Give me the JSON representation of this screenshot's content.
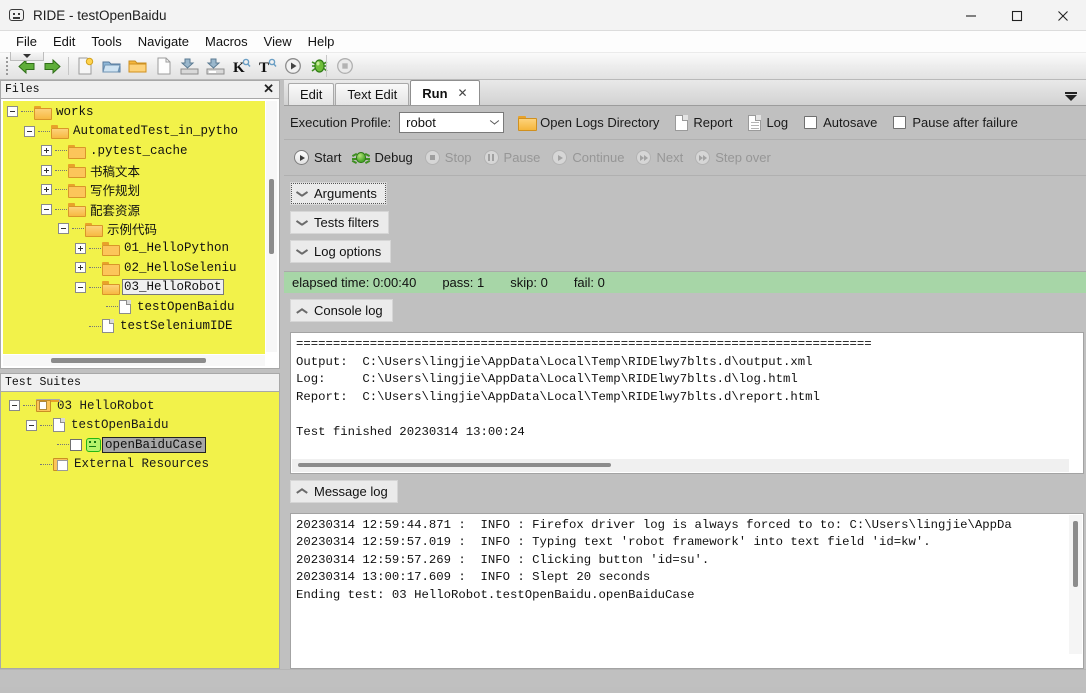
{
  "window": {
    "title": "RIDE - testOpenBaidu",
    "icon": "robot-face-icon",
    "controls": {
      "minimize": "—",
      "maximize": "□",
      "close": "✕"
    }
  },
  "menubar": {
    "items": [
      "File",
      "Edit",
      "Tools",
      "Navigate",
      "Macros",
      "View",
      "Help"
    ]
  },
  "toolbar": {
    "buttons": [
      {
        "name": "back-icon",
        "glyph": "green-left-arrow"
      },
      {
        "name": "forward-icon",
        "glyph": "green-right-arrow"
      },
      {
        "name": "new-project-icon",
        "glyph": "page-new"
      },
      {
        "name": "open-directory-icon",
        "glyph": "folder-open-blue"
      },
      {
        "name": "open-folder-icon",
        "glyph": "folder-yellow"
      },
      {
        "name": "new-file-icon",
        "glyph": "page-blank"
      },
      {
        "name": "save-icon",
        "glyph": "floppy-down"
      },
      {
        "name": "save-all-icon",
        "glyph": "floppy-down-all"
      },
      {
        "name": "search-keyword-icon",
        "glyph": "K"
      },
      {
        "name": "search-tests-icon",
        "glyph": "T"
      },
      {
        "name": "run-icon",
        "glyph": "play-circle"
      },
      {
        "name": "debug-icon",
        "glyph": "green-bug"
      },
      {
        "name": "stop-icon",
        "glyph": "stop-circle"
      }
    ]
  },
  "files_panel": {
    "title": "Files",
    "close_label": "✕",
    "tree": [
      {
        "label": "works",
        "depth": 0,
        "toggle": "minus",
        "icon": "folder"
      },
      {
        "label": "AutomatedTest_in_pytho",
        "depth": 1,
        "toggle": "minus",
        "icon": "folder"
      },
      {
        "label": ".pytest_cache",
        "depth": 2,
        "toggle": "plus",
        "icon": "folder"
      },
      {
        "label": "书稿文本",
        "depth": 2,
        "toggle": "plus",
        "icon": "folder"
      },
      {
        "label": "写作规划",
        "depth": 2,
        "toggle": "plus",
        "icon": "folder"
      },
      {
        "label": "配套资源",
        "depth": 2,
        "toggle": "minus",
        "icon": "folder"
      },
      {
        "label": "示例代码",
        "depth": 3,
        "toggle": "minus",
        "icon": "folder"
      },
      {
        "label": "01_HelloPython",
        "depth": 4,
        "toggle": "plus",
        "icon": "folder"
      },
      {
        "label": "02_HelloSeleniu",
        "depth": 4,
        "toggle": "plus",
        "icon": "folder"
      },
      {
        "label": "03_HelloRobot",
        "depth": 4,
        "toggle": "minus",
        "icon": "folder",
        "selected": true
      },
      {
        "label": "testOpenBaidu",
        "depth": 5,
        "toggle": "none",
        "icon": "file"
      },
      {
        "label": "testSeleniumIDE",
        "depth": 4,
        "toggle": "none",
        "icon": "file"
      }
    ]
  },
  "suites_panel": {
    "title": "Test Suites",
    "tree": [
      {
        "label": "03 HelloRobot",
        "depth": 0,
        "toggle": "minus",
        "icon": "suite-folder"
      },
      {
        "label": "testOpenBaidu",
        "depth": 1,
        "toggle": "minus",
        "icon": "file"
      },
      {
        "label": "openBaiduCase",
        "depth": 2,
        "toggle": "none",
        "icon": "robot-test",
        "checkbox": true,
        "selected": true
      },
      {
        "label": "External Resources",
        "depth": 1,
        "toggle": "none",
        "icon": "external-resources"
      }
    ]
  },
  "tabs": {
    "items": [
      {
        "label": "Edit",
        "active": false,
        "closable": false
      },
      {
        "label": "Text Edit",
        "active": false,
        "closable": false
      },
      {
        "label": "Run",
        "active": true,
        "closable": true,
        "close_label": "✕"
      }
    ],
    "overflow_icon": "chevron-down-icon"
  },
  "run": {
    "execution_profile_label": "Execution Profile:",
    "profile_value": "robot",
    "open_logs_label": "Open Logs Directory",
    "report_label": "Report",
    "log_label": "Log",
    "autosave_label": "Autosave",
    "autosave_checked": false,
    "pause_after_failure_label": "Pause after failure",
    "pause_after_failure_checked": false,
    "controls": [
      {
        "label": "Start",
        "enabled": true,
        "icon": "play-circle-icon"
      },
      {
        "label": "Debug",
        "enabled": true,
        "icon": "bug-icon"
      },
      {
        "label": "Stop",
        "enabled": false,
        "icon": "stop-circle-icon"
      },
      {
        "label": "Pause",
        "enabled": false,
        "icon": "pause-circle-icon"
      },
      {
        "label": "Continue",
        "enabled": false,
        "icon": "play-circle-icon"
      },
      {
        "label": "Next",
        "enabled": false,
        "icon": "next-circle-icon"
      },
      {
        "label": "Step over",
        "enabled": false,
        "icon": "step-over-circle-icon"
      }
    ],
    "sections": [
      {
        "label": "Arguments",
        "expanded": false,
        "focused": true
      },
      {
        "label": "Tests filters",
        "expanded": false,
        "focused": false
      },
      {
        "label": "Log options",
        "expanded": false,
        "focused": false
      }
    ],
    "status": {
      "elapsed": "elapsed time: 0:00:40",
      "pass": "pass: 1",
      "skip": "skip: 0",
      "fail": "fail: 0",
      "color": "#a7d6a7"
    },
    "console_log": {
      "label": "Console log",
      "expanded": true,
      "lines": [
        "==============================================================================",
        "Output:  C:\\Users\\lingjie\\AppData\\Local\\Temp\\RIDElwy7blts.d\\output.xml",
        "Log:     C:\\Users\\lingjie\\AppData\\Local\\Temp\\RIDElwy7blts.d\\log.html",
        "Report:  C:\\Users\\lingjie\\AppData\\Local\\Temp\\RIDElwy7blts.d\\report.html",
        "",
        "Test finished 20230314 13:00:24"
      ]
    },
    "message_log": {
      "label": "Message log",
      "expanded": true,
      "lines": [
        "20230314 12:59:44.871 :  INFO : Firefox driver log is always forced to to: C:\\Users\\lingjie\\AppDa",
        "20230314 12:59:57.019 :  INFO : Typing text 'robot framework' into text field 'id=kw'.",
        "20230314 12:59:57.269 :  INFO : Clicking button 'id=su'.",
        "20230314 13:00:17.609 :  INFO : Slept 20 seconds",
        "Ending test: 03 HelloRobot.testOpenBaidu.openBaiduCase"
      ]
    }
  }
}
